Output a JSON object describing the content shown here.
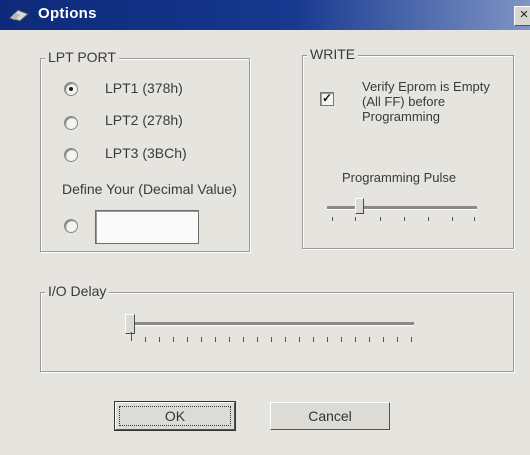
{
  "window": {
    "title": "Options",
    "close_label": "×"
  },
  "lpt_port": {
    "label": "LPT PORT",
    "options": [
      {
        "label": "LPT1 (378h)",
        "checked": true
      },
      {
        "label": "LPT2 (278h)",
        "checked": false
      },
      {
        "label": "LPT3 (3BCh)",
        "checked": false
      }
    ],
    "custom_label": "Define Your (Decimal Value)",
    "custom_value": ""
  },
  "write": {
    "label": "WRITE",
    "verify_label_line1": "Verify Eprom is Empty",
    "verify_label_line2": "(All FF) before",
    "verify_label_line3": "Programming",
    "verify_checked": true,
    "check_glyph": "✓",
    "pulse_label": "Programming Pulse",
    "pulse_level": 0.2
  },
  "io_delay": {
    "label": "I/O Delay",
    "level": 0.0
  },
  "buttons": {
    "ok": "OK",
    "cancel": "Cancel"
  }
}
